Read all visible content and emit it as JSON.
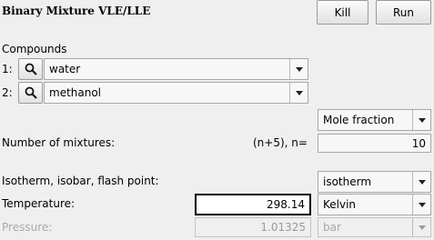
{
  "window": {
    "title": "Binary Mixture VLE/LLE"
  },
  "toolbar": {
    "kill_label": "Kill",
    "run_label": "Run"
  },
  "compounds": {
    "heading": "Compounds",
    "items": [
      {
        "index": "1:",
        "name": "water"
      },
      {
        "index": "2:",
        "name": "methanol"
      }
    ]
  },
  "composition": {
    "unit": "Mole fraction"
  },
  "mixtures": {
    "label": "Number of mixtures:",
    "formula": "(n+5), n=",
    "value": "10"
  },
  "mode": {
    "label": "Isotherm, isobar, flash point:",
    "value": "isotherm"
  },
  "temperature": {
    "label": "Temperature:",
    "value": "298.14",
    "unit": "Kelvin"
  },
  "pressure": {
    "label": "Pressure:",
    "value": "1.01325",
    "unit": "bar"
  },
  "icons": {
    "search": "search-icon",
    "dropdown": "chevron-down-icon"
  }
}
